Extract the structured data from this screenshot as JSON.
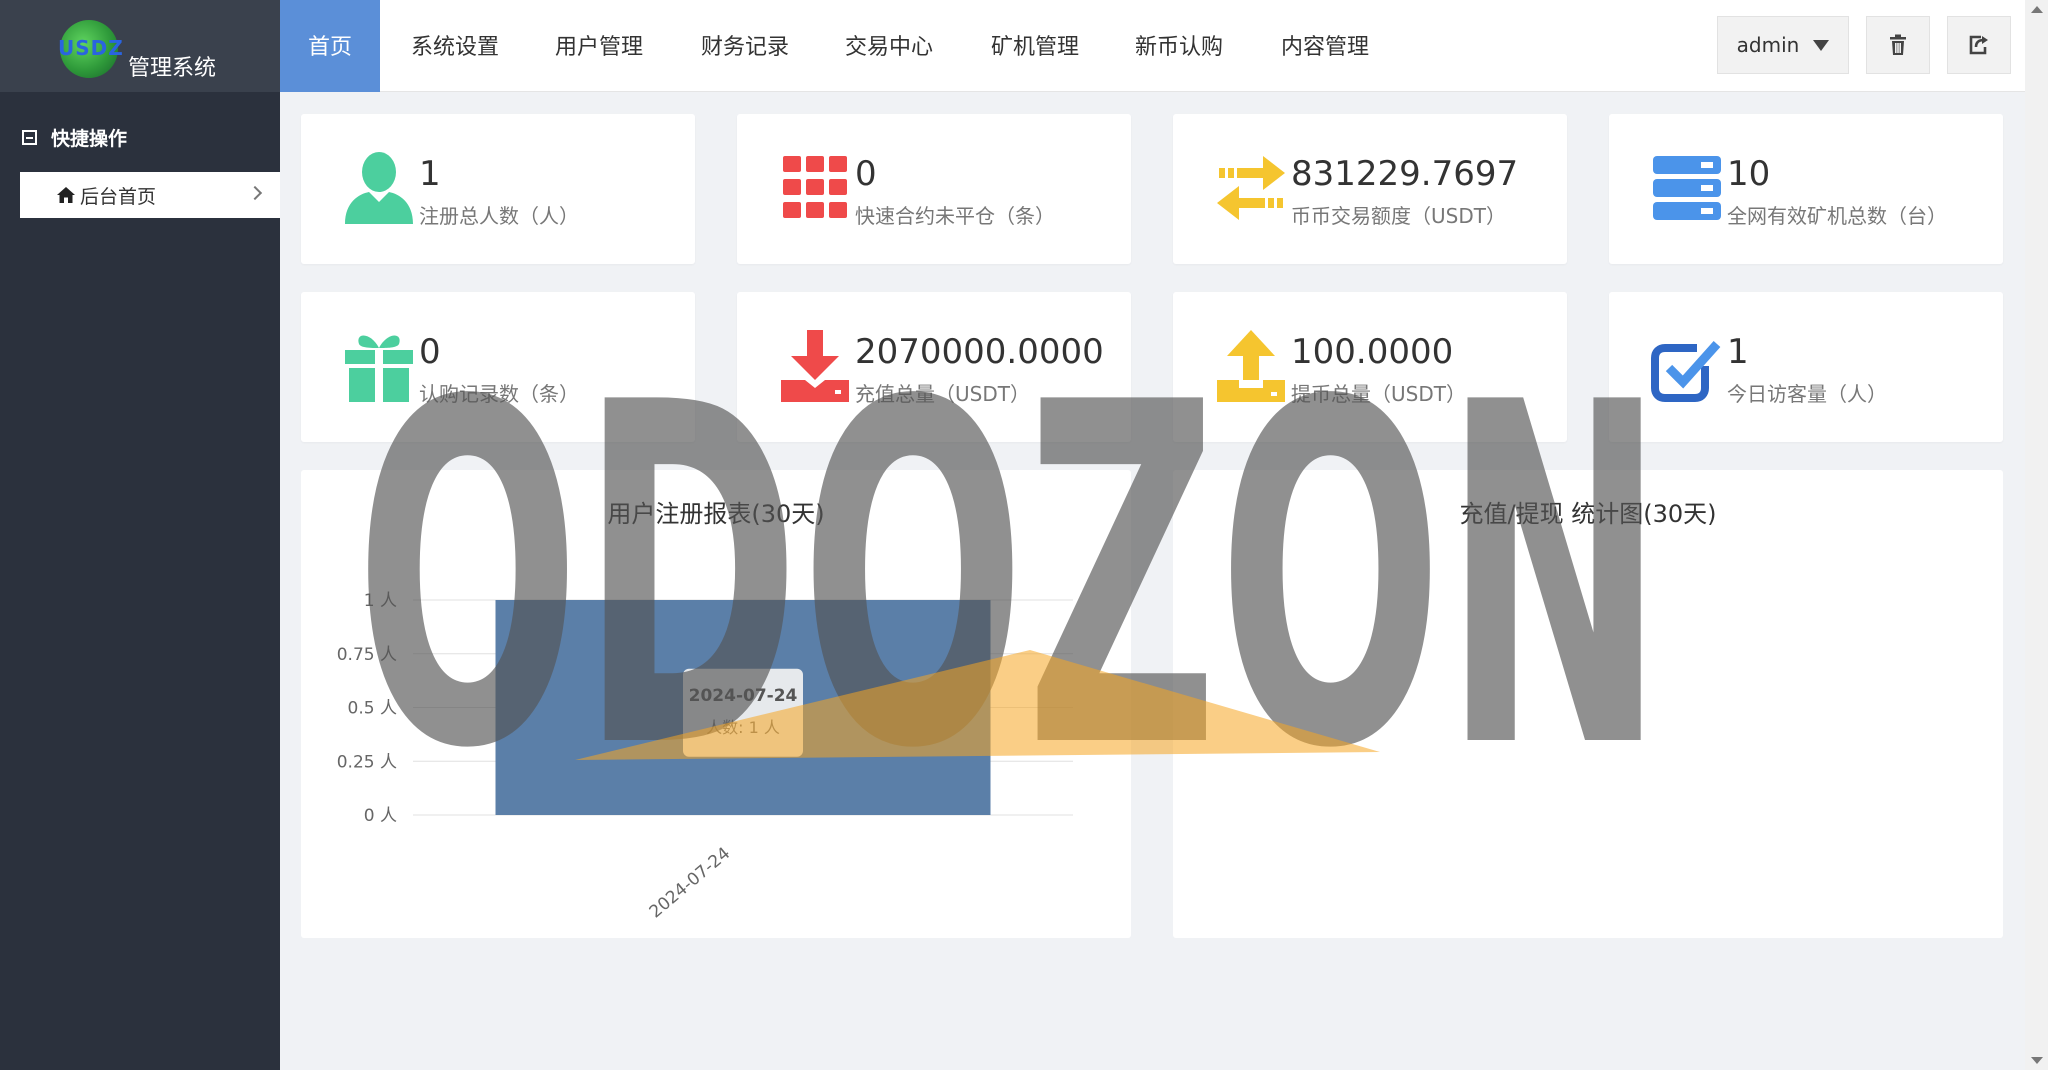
{
  "app": {
    "logo_text": "USDZ",
    "system_name": "管理系统"
  },
  "sidebar": {
    "section_title": "快捷操作",
    "items": [
      {
        "label": "后台首页",
        "icon": "home-icon"
      }
    ]
  },
  "topnav": {
    "tabs": [
      {
        "label": "首页",
        "active": true
      },
      {
        "label": "系统设置"
      },
      {
        "label": "用户管理"
      },
      {
        "label": "财务记录"
      },
      {
        "label": "交易中心"
      },
      {
        "label": "矿机管理"
      },
      {
        "label": "新币认购"
      },
      {
        "label": "内容管理"
      }
    ],
    "user": "admin",
    "trash_icon": "trash-icon",
    "exit_icon": "exit-icon",
    "active_color": "#5b8fd8"
  },
  "stats": [
    {
      "value": "1",
      "label": "注册总人数（人）",
      "icon": "user-icon",
      "color": "#4ccf9e"
    },
    {
      "value": "0",
      "label": "快速合约未平仓（条）",
      "icon": "grid-icon",
      "color": "#ef4a4a"
    },
    {
      "value": "831229.7697",
      "label": "币币交易额度（USDT）",
      "icon": "exchange-icon",
      "color": "#f5c52f"
    },
    {
      "value": "10",
      "label": "全网有效矿机总数（台）",
      "icon": "server-icon",
      "color": "#4b94ea"
    },
    {
      "value": "0",
      "label": "认购记录数（条）",
      "icon": "gift-icon",
      "color": "#4ccf9e"
    },
    {
      "value": "2070000.0000",
      "label": "充值总量（USDT）",
      "icon": "download-icon",
      "color": "#ef4a4a"
    },
    {
      "value": "100.0000",
      "label": "提币总量（USDT）",
      "icon": "upload-icon",
      "color": "#f5c52f"
    },
    {
      "value": "1",
      "label": "今日访客量（人）",
      "icon": "check-icon",
      "color": "#4b94ea"
    }
  ],
  "panels": {
    "left_title": "用户注册报表(30天)",
    "right_title": "充值/提现 统计图(30天)"
  },
  "chart_data": {
    "type": "bar",
    "title": "用户注册报表(30天)",
    "categories": [
      "2024-07-24"
    ],
    "values": [
      1
    ],
    "y_ticks": [
      "0 人",
      "0.25 人",
      "0.5 人",
      "0.75 人",
      "1 人"
    ],
    "ylim": [
      0,
      1
    ],
    "bar_color": "#5b7fa8",
    "tooltip": {
      "title": "2024-07-24",
      "text": "人数: 1 人"
    }
  },
  "watermark": {
    "text": "ODOZON",
    "accent_color": "#f5a623"
  }
}
